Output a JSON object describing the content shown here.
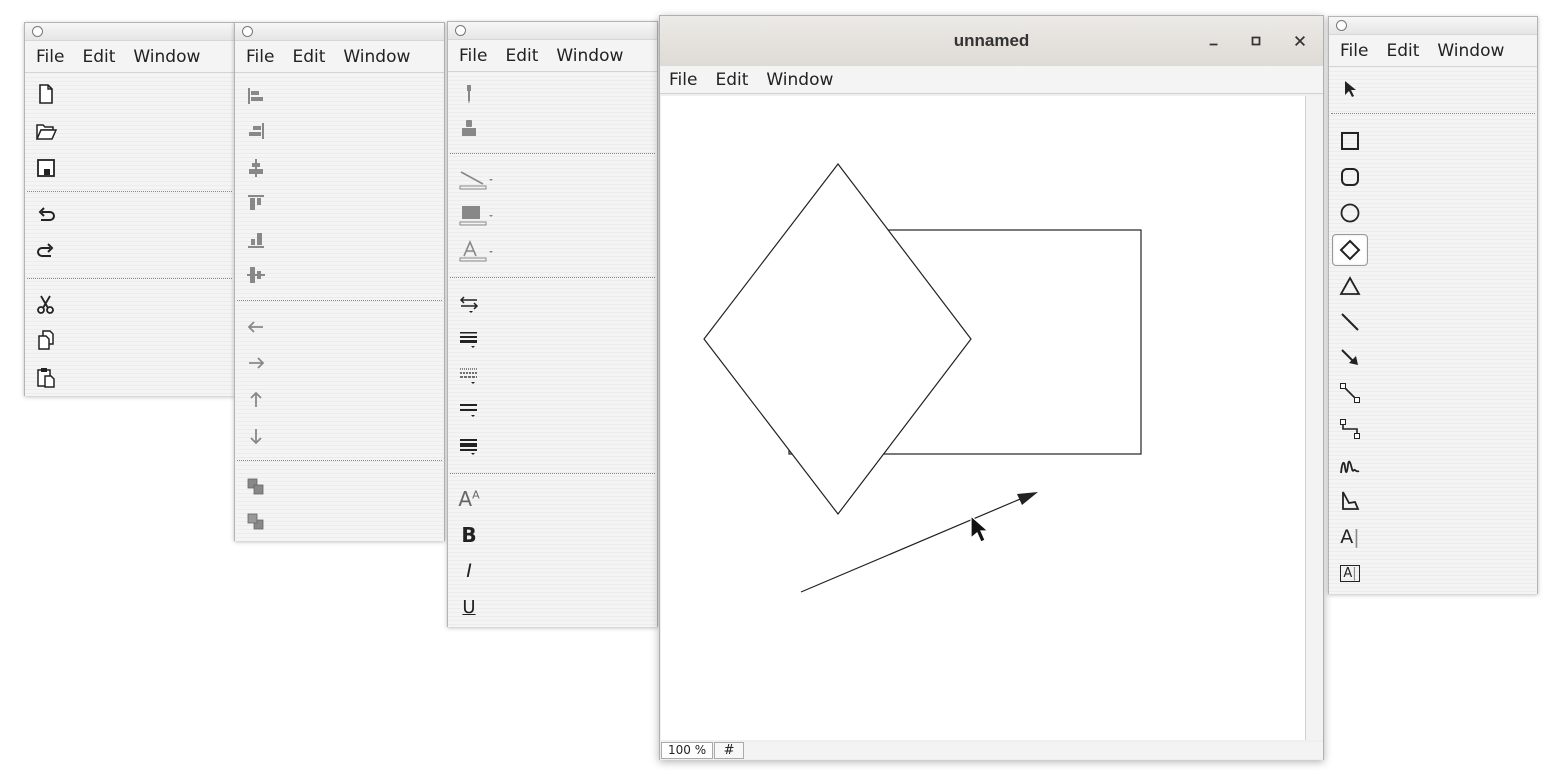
{
  "menu": {
    "file": "File",
    "edit": "Edit",
    "window": "Window"
  },
  "main_window": {
    "title": "unnamed"
  },
  "status": {
    "zoom": "100 %",
    "grid_toggle": "#"
  },
  "palettes": {
    "file_tools": [
      "new-document",
      "open-folder",
      "save-disk",
      "undo-arrow",
      "redo-arrow",
      "cut-scissors",
      "copy",
      "paste"
    ],
    "align_tools": [
      "align-left",
      "align-right",
      "align-center-horizontal",
      "align-top",
      "align-bottom",
      "align-center-vertical",
      "move-left",
      "move-right",
      "move-up",
      "move-down",
      "bring-to-front",
      "send-to-back"
    ],
    "attribute_tools": [
      "pick-attributes",
      "apply-attributes",
      "stroke-color",
      "fill-color",
      "text-color",
      "arrow-style",
      "stroke-width",
      "stroke-dash",
      "stroke-type",
      "stroke-placement",
      "font-size",
      "bold",
      "italic",
      "underline"
    ],
    "draw_tools": [
      "selection-tool",
      "rectangle-tool",
      "rounded-rectangle-tool",
      "ellipse-tool",
      "diamond-tool",
      "triangle-tool",
      "line-tool",
      "arrow-tool",
      "link-line-tool",
      "elbow-line-tool",
      "scribble-tool",
      "polygon-tool",
      "text-tool",
      "text-area-tool"
    ],
    "selected_draw_tool": "diamond-tool"
  },
  "text": {
    "bold": "B",
    "italic": "I",
    "underline": "U",
    "font_size": "A",
    "text_tool": "A",
    "text_area_tool": "A"
  },
  "colors": {
    "accent_gray": "#888888",
    "icon_dark": "#2b2b2b"
  }
}
